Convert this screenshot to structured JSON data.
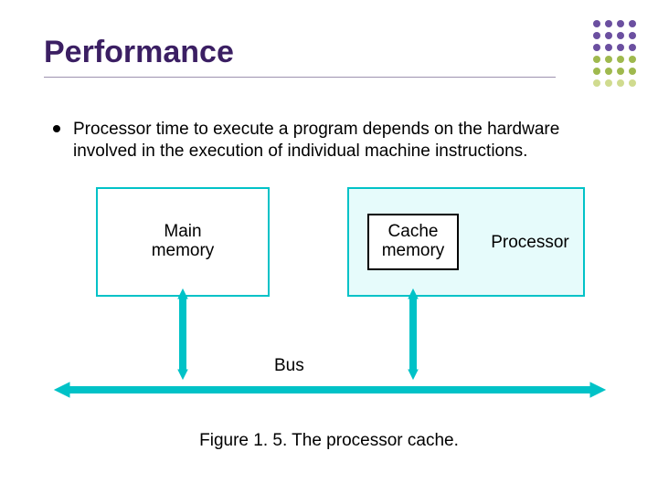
{
  "title": "Performance",
  "bullet_text": "Processor time to execute a program depends on the hardware involved in the execution of individual machine instructions.",
  "diagram": {
    "main_memory": "Main\nmemory",
    "cache_memory": "Cache\nmemory",
    "processor": "Processor",
    "bus_label": "Bus"
  },
  "caption": "Figure 1. 5.   The processor cache.",
  "colors": {
    "title": "#3b1f63",
    "box_border": "#00c2c7",
    "proc_bg": "#e6fbfb",
    "arrow": "#00c2c7"
  }
}
